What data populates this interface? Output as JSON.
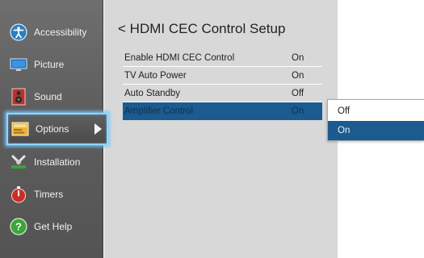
{
  "sidebar": {
    "items": [
      {
        "label": "Accessibility",
        "icon": "accessibility-icon"
      },
      {
        "label": "Picture",
        "icon": "picture-icon"
      },
      {
        "label": "Sound",
        "icon": "sound-icon"
      },
      {
        "label": "Options",
        "icon": "options-icon"
      },
      {
        "label": "Installation",
        "icon": "installation-icon"
      },
      {
        "label": "Timers",
        "icon": "timers-icon"
      },
      {
        "label": "Get Help",
        "icon": "get-help-icon"
      }
    ],
    "selected": "Options"
  },
  "panel": {
    "back_glyph": "<",
    "title": "HDMI CEC Control Setup",
    "rows": [
      {
        "label": "Enable HDMI CEC Control",
        "value": "On"
      },
      {
        "label": "TV Auto Power",
        "value": "On"
      },
      {
        "label": "Auto Standby",
        "value": "Off"
      },
      {
        "label": "Amplifier Control",
        "value": "On"
      }
    ],
    "active_row": "Amplifier Control"
  },
  "popup": {
    "options": [
      "Off",
      "On"
    ],
    "selected": "On"
  },
  "colors": {
    "highlight": "#1b5b8f",
    "focus_glow": "#8fd6ff",
    "sidebar_bg": "#5d5d5d",
    "panel_bg": "#d8d8d8"
  }
}
